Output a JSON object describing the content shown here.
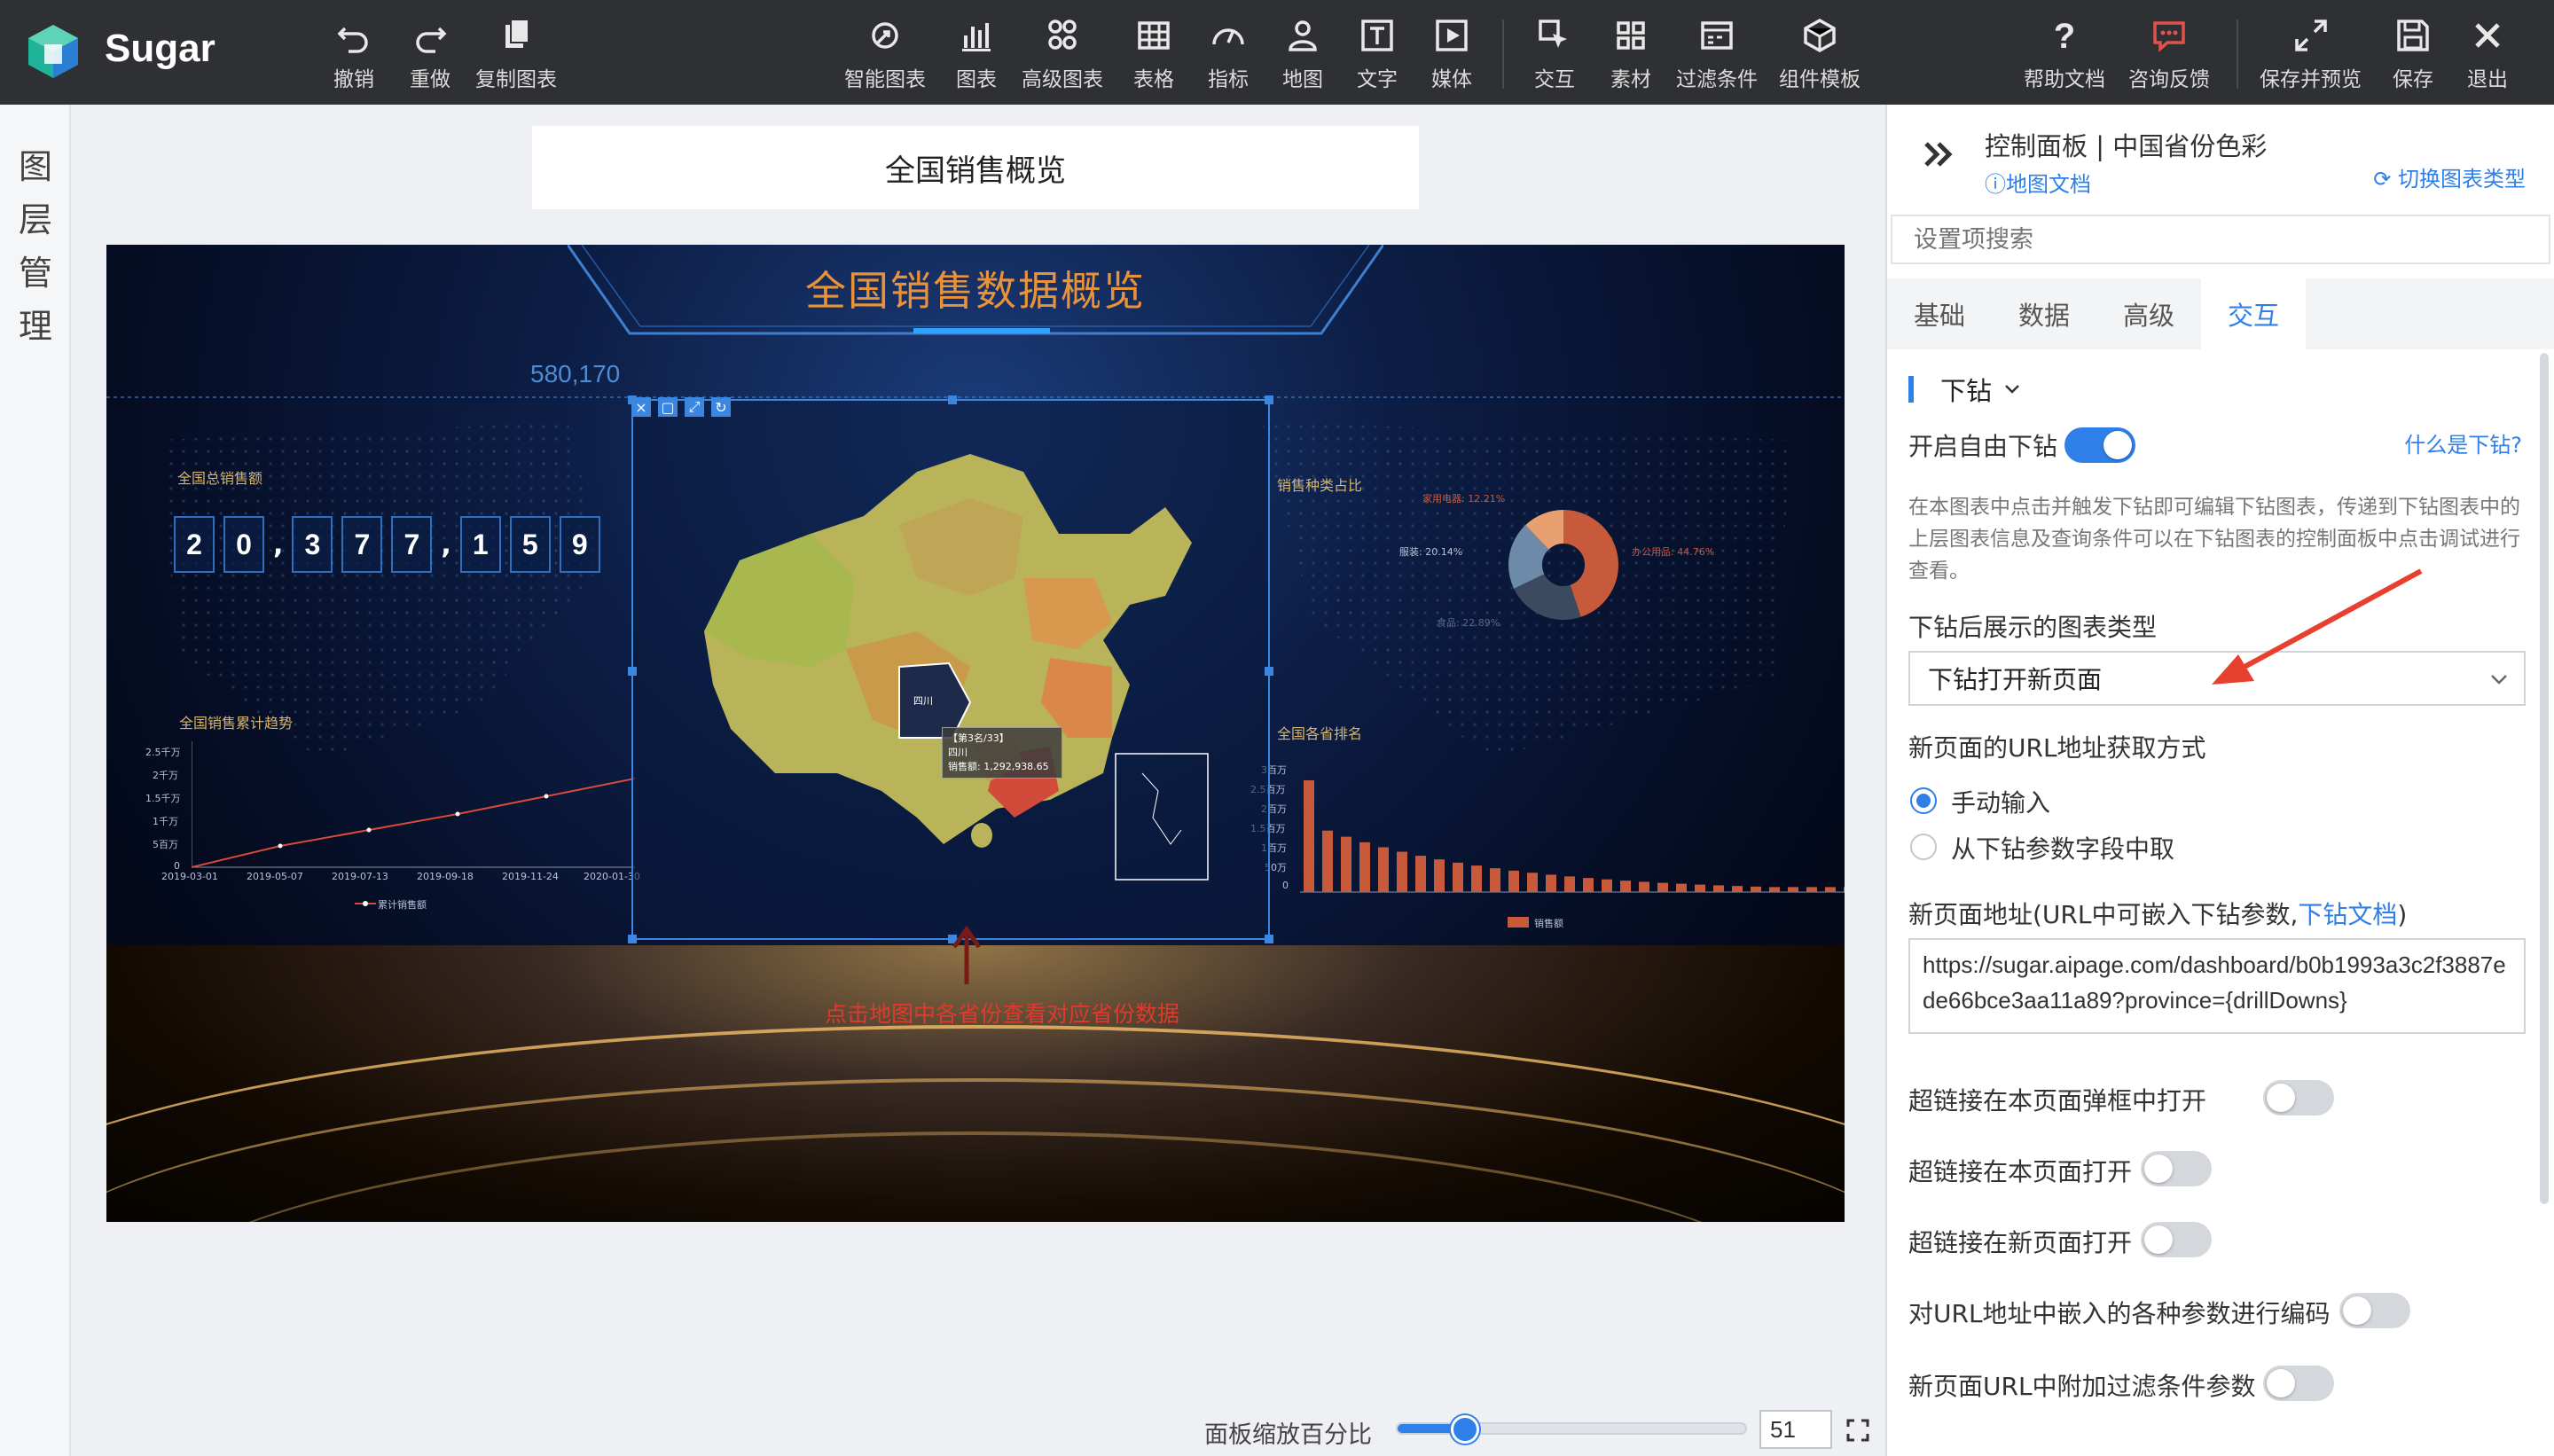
{
  "app": {
    "name": "Sugar"
  },
  "toolbar": {
    "undo": "撤销",
    "redo": "重做",
    "copy_chart": "复制图表",
    "smart_chart": "智能图表",
    "chart": "图表",
    "advanced_chart": "高级图表",
    "table": "表格",
    "indicator": "指标",
    "map": "地图",
    "text": "文字",
    "media": "媒体",
    "interaction": "交互",
    "material": "素材",
    "filter": "过滤条件",
    "component_template": "组件模板",
    "help_doc": "帮助文档",
    "feedback": "咨询反馈",
    "save_preview": "保存并预览",
    "save": "保存",
    "exit": "退出"
  },
  "layer_panel": {
    "label": "图层管理"
  },
  "canvas": {
    "page_title": "全国销售概览",
    "dashboard_title": "全国销售数据概览",
    "selected_value": "580,170",
    "total_sales_label": "全国总销售额",
    "total_sales_digits": [
      "2",
      "0",
      ",",
      "3",
      "7",
      "7",
      ",",
      "1",
      "5",
      "9"
    ],
    "trend_title": "全国销售累计趋势",
    "trend_y_ticks": [
      "2.5千万",
      "2千万",
      "1.5千万",
      "1千万",
      "5百万",
      "0"
    ],
    "trend_x_ticks": [
      "2019-03-01",
      "2019-05-07",
      "2019-07-13",
      "2019-09-18",
      "2019-11-24",
      "2020-01-30"
    ],
    "trend_legend": "累计销售额",
    "category_title": "销售种类占比",
    "pie_labels": [
      "家用电器: 12.21%",
      "服装: 20.14%",
      "办公用品: 44.76%",
      "食品: 22.89%"
    ],
    "ranking_title": "全国各省排名",
    "ranking_y_ticks": [
      "3百万",
      "2.5百万",
      "2百万",
      "1.5百万",
      "1百万",
      "50万",
      "0"
    ],
    "ranking_legend": "销售额",
    "tooltip_rank": "【第3名/33】",
    "tooltip_province": "四川",
    "tooltip_sales": "销售额: 1,292,938.65",
    "map_province_label": "四川",
    "map_hint": "点击地图中各省份查看对应省份数据"
  },
  "zoom": {
    "label": "面板缩放百分比",
    "value": "51",
    "percent": 51
  },
  "control_panel": {
    "title": "控制面板 | 中国省份色彩",
    "map_doc": "地图文档",
    "switch_chart_type": "切换图表类型",
    "search_placeholder": "设置项搜索",
    "tabs": [
      "基础",
      "数据",
      "高级",
      "交互"
    ],
    "active_tab": "交互",
    "section": "下钻",
    "enable_drilldown": "开启自由下钻",
    "what_is_drilldown": "什么是下钻?",
    "drilldown_desc": "在本图表中点击并触发下钻即可编辑下钻图表，传递到下钻图表中的上层图表信息及查询条件可以在下钻图表的控制面板中点击调试进行查看。",
    "chart_type_label": "下钻后展示的图表类型",
    "chart_type_value": "下钻打开新页面",
    "url_method_label": "新页面的URL地址获取方式",
    "url_method_manual": "手动输入",
    "url_method_field": "从下钻参数字段中取",
    "url_label_prefix": "新页面地址(URL中可嵌入下钻参数,",
    "url_label_link": "下钻文档",
    "url_label_suffix": ")",
    "url_value": "https://sugar.aipage.com/dashboard/b0b1993a3c2f3887ede66bce3aa11a89?province={drillDowns}",
    "opt_modal": "超链接在本页面弹框中打开",
    "opt_this_page": "超链接在本页面打开",
    "opt_new_page": "超链接在新页面打开",
    "opt_encode": "对URL地址中嵌入的各种参数进行编码",
    "opt_filter": "新页面URL中附加过滤条件参数"
  },
  "colors": {
    "accent": "#2f7fe8",
    "toolbar_bg": "#2f3033",
    "dashboard_title": "#e8923a",
    "hint_red": "#e03a2f"
  }
}
